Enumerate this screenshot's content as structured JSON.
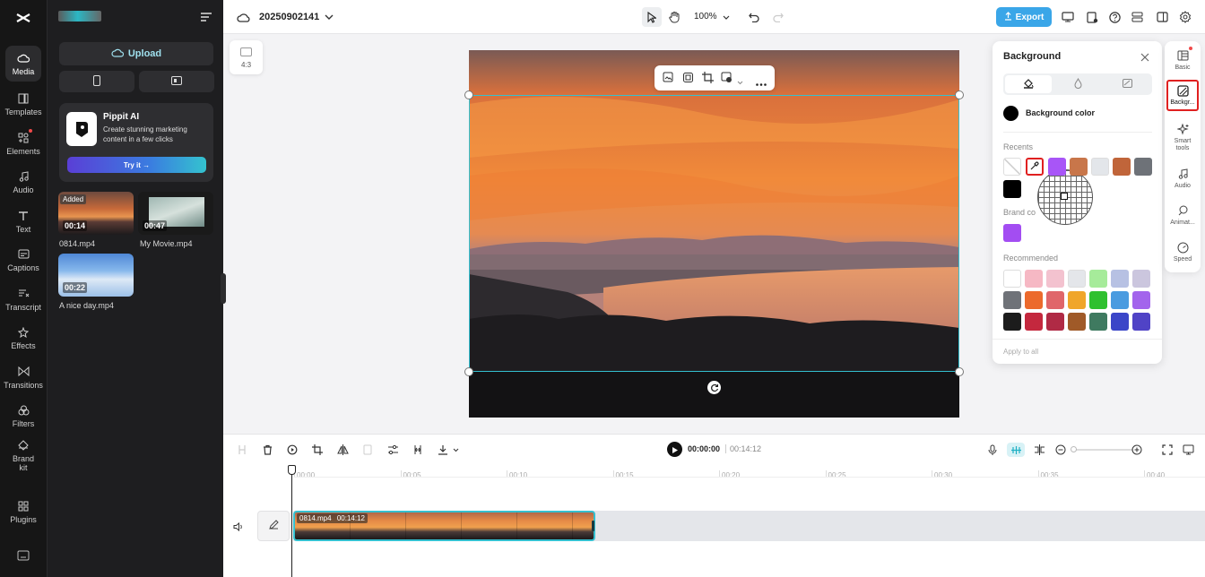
{
  "project": {
    "name": "20250902141"
  },
  "zoom": "100%",
  "export_label": "Export",
  "aspect_label": "4:3",
  "nav": [
    {
      "label": "Media",
      "icon": "media-icon"
    },
    {
      "label": "Templates",
      "icon": "templates-icon"
    },
    {
      "label": "Elements",
      "icon": "elements-icon"
    },
    {
      "label": "Audio",
      "icon": "audio-icon"
    },
    {
      "label": "Text",
      "icon": "text-icon"
    },
    {
      "label": "Captions",
      "icon": "captions-icon"
    },
    {
      "label": "Transcript",
      "icon": "transcript-icon"
    },
    {
      "label": "Effects",
      "icon": "effects-icon"
    },
    {
      "label": "Transitions",
      "icon": "transitions-icon"
    },
    {
      "label": "Filters",
      "icon": "filters-icon"
    },
    {
      "label": "Brand kit",
      "icon": "brand-kit-icon"
    },
    {
      "label": "Plugins",
      "icon": "plugins-icon"
    }
  ],
  "media": {
    "upload_label": "Upload",
    "promo": {
      "title": "Pippit AI",
      "desc": "Create stunning marketing content in a few clicks",
      "cta": "Try it →"
    },
    "files": [
      {
        "name": "0814.mp4",
        "duration": "00:14",
        "badge": "Added"
      },
      {
        "name": "My Movie.mp4",
        "duration": "00:47"
      },
      {
        "name": "A nice day.mp4",
        "duration": "00:22"
      }
    ]
  },
  "background_panel": {
    "title": "Background",
    "color_label": "Background color",
    "recents_label": "Recents",
    "brand_label": "Brand co",
    "recommended_label": "Recommended",
    "apply_all": "Apply to all",
    "recent_colors": [
      "#a855f7",
      "#c8764a",
      "#e3e6ea",
      "#c0653a",
      "#6e7278",
      "#000000"
    ],
    "brand_colors": [
      "#a34df2"
    ],
    "recommended_colors": [
      "#ffffff",
      "#f6b8c4",
      "#f3c2cf",
      "#e4e6ea",
      "#a6eb9a",
      "#b7c1e3",
      "#cbc6de",
      "#6f7278",
      "#ec6a2c",
      "#e0666a",
      "#f0a62a",
      "#2fc02f",
      "#4a9be0",
      "#a364ec",
      "#1c1c1c",
      "#c4283e",
      "#b02a45",
      "#a05a28",
      "#3f7a60",
      "#3b46c8",
      "#5043c6"
    ]
  },
  "right_rail": [
    {
      "label": "Basic",
      "icon": "basic-icon"
    },
    {
      "label": "Backgr...",
      "icon": "background-icon"
    },
    {
      "label": "Smart tools",
      "icon": "smart-tools-icon"
    },
    {
      "label": "Audio",
      "icon": "audio-icon"
    },
    {
      "label": "Animat...",
      "icon": "animation-icon"
    },
    {
      "label": "Speed",
      "icon": "speed-icon"
    }
  ],
  "timeline": {
    "current_time": "00:00:00",
    "total_time": "00:14:12",
    "ticks": [
      "00:00",
      "00:05",
      "00:10",
      "00:15",
      "00:20",
      "00:25",
      "00:30",
      "00:35",
      "00:40"
    ],
    "clip": {
      "name": "0814.mp4",
      "duration": "00:14:12"
    }
  },
  "colors": {
    "accent": "#3aa6e8",
    "selection": "#34c0d0",
    "highlight": "#e02020"
  }
}
